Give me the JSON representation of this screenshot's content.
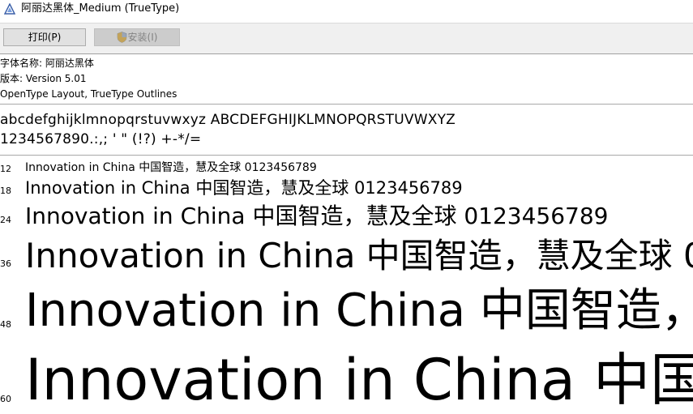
{
  "window": {
    "title": "阿丽达黑体_Medium (TrueType)"
  },
  "toolbar": {
    "print_label": "打印(P)",
    "install_label": "安装(I)"
  },
  "info": {
    "font_name": "字体名称: 阿丽达黑体",
    "version": "版本: Version 5.01",
    "outlines": "OpenType Layout, TrueType Outlines"
  },
  "charset": {
    "line1": "abcdefghijklmnopqrstuvwxyz ABCDEFGHIJKLMNOPQRSTUVWXYZ",
    "line2": "1234567890.:,; ' \" (!?) +-*/="
  },
  "samples": {
    "text": "Innovation in China 中国智造，慧及全球 0123456789",
    "rows": [
      {
        "size": "12"
      },
      {
        "size": "18"
      },
      {
        "size": "24"
      },
      {
        "size": "36"
      },
      {
        "size": "48"
      },
      {
        "size": "60"
      }
    ]
  },
  "colors": {
    "toolbar_bg": "#f0f0f0",
    "button_bg": "#e1e1e1",
    "disabled_text": "#838383",
    "divider": "#a8a8a8"
  },
  "icons": {
    "app": "font-viewer-icon",
    "install": "uac-shield-icon"
  }
}
